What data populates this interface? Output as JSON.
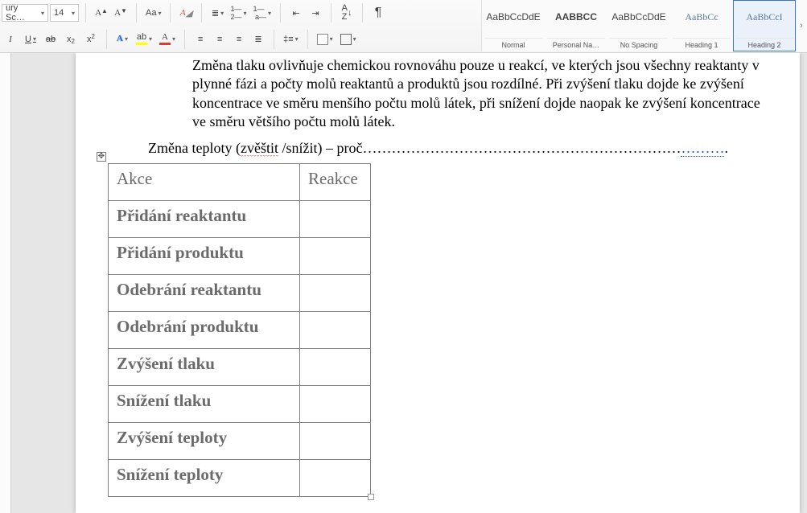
{
  "toolbar": {
    "font_name": "ury Sc…",
    "font_size": "14",
    "styles": [
      {
        "sample": "AaBbCcDdE",
        "name": "Normal",
        "sampleClass": ""
      },
      {
        "sample": "AABBCC",
        "name": "Personal Na…",
        "sampleClass": "bold"
      },
      {
        "sample": "AaBbCcDdE",
        "name": "No Spacing",
        "sampleClass": ""
      },
      {
        "sample": "AaBbCc",
        "name": "Heading 1",
        "sampleClass": "h"
      },
      {
        "sample": "AaBbCcI",
        "name": "Heading 2",
        "sampleClass": "h"
      }
    ],
    "selected_style_index": 4
  },
  "document": {
    "para1": "Změna tlaku ovlivňuje chemickou rovnováhu pouze u reakcí, ve kterých jsou všechny reaktanty v plynné fázi a počty molů reaktantů a produktů jsou rozdílné. Při zvýšení tlaku dojde ke zvýšení koncentrace ve směru menšího počtu molů látek, při snížení dojde naopak ke zvýšení koncentrace ve směru většího počtu molů látek.",
    "para2_pre": "Změna teploty (",
    "para2_squiggle": "zvěštit",
    "para2_mid": " /snížit) – proč",
    "para2_dots": "…………………………………………………………",
    "para2_link": "………",
    "table": {
      "headers": [
        "Akce",
        "Reakce"
      ],
      "rows": [
        "Přidání reaktantu",
        "Přidání produktu",
        "Odebrání reaktantu",
        "Odebrání produktu",
        "Zvýšení tlaku",
        "Snížení tlaku",
        "Zvýšení teploty",
        "Snížení teploty"
      ]
    }
  }
}
